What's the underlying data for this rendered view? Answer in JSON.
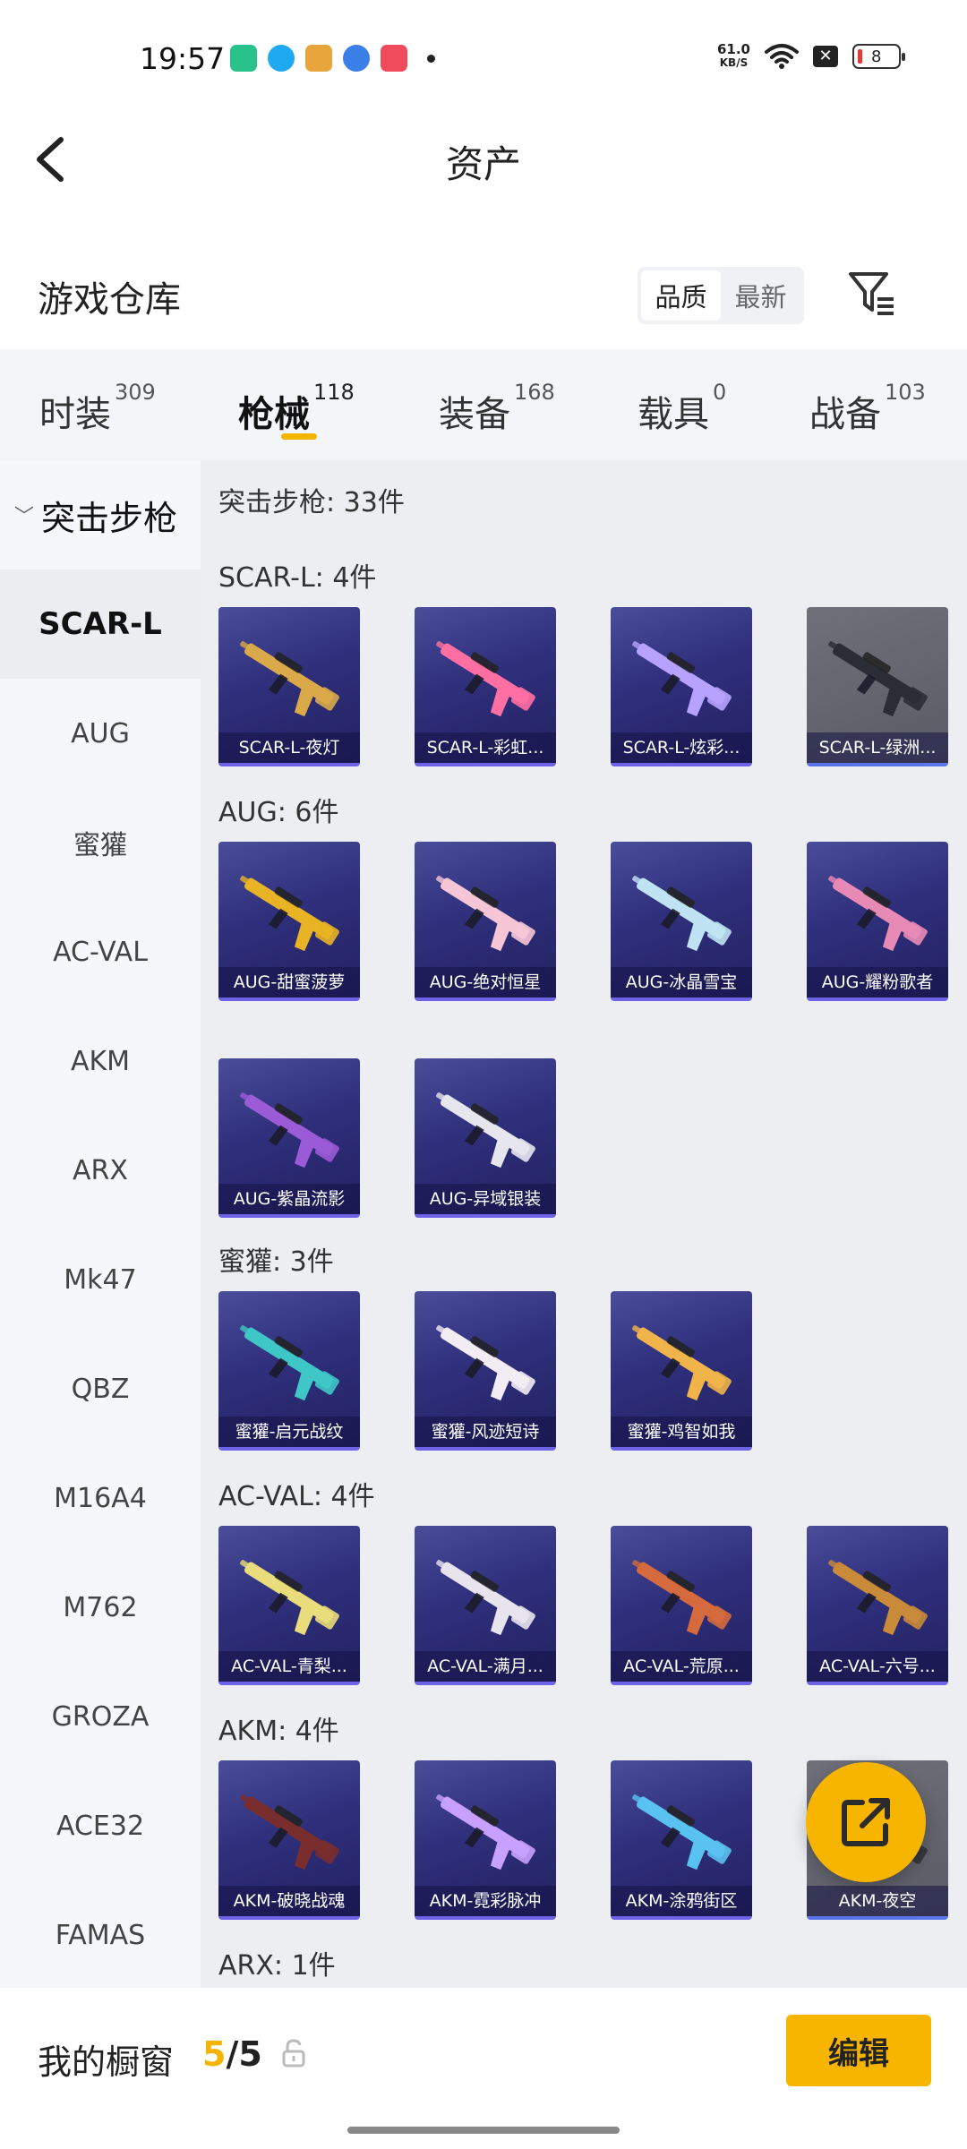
{
  "status_bar": {
    "time": "19:57",
    "net_speed_value": "61.0",
    "net_speed_unit": "KB/S",
    "battery": "8"
  },
  "header": {
    "title": "资产",
    "back_icon": "chevron-left-icon"
  },
  "warehouse": {
    "title": "游戏仓库",
    "sort_options": [
      "品质",
      "最新"
    ],
    "sort_selected": "品质",
    "filter_icon": "filter-icon"
  },
  "tabs": [
    {
      "label": "时装",
      "count": "309"
    },
    {
      "label": "枪械",
      "count": "118",
      "active": true
    },
    {
      "label": "装备",
      "count": "168"
    },
    {
      "label": "载具",
      "count": "0"
    },
    {
      "label": "战备",
      "count": "103"
    }
  ],
  "sidebar": {
    "category": "突击步枪",
    "items": [
      "SCAR-L",
      "AUG",
      "蜜獾",
      "AC-VAL",
      "AKM",
      "ARX",
      "Mk47",
      "QBZ",
      "M16A4",
      "M762",
      "GROZA",
      "ACE32",
      "FAMAS"
    ],
    "selected": "SCAR-L"
  },
  "content": {
    "title": "突击步枪: 33件",
    "groups": [
      {
        "title": "SCAR-L: 4件",
        "items": [
          "SCAR-L-夜灯",
          "SCAR-L-彩虹...",
          "SCAR-L-炫彩...",
          "SCAR-L-绿洲..."
        ]
      },
      {
        "title": "AUG: 6件",
        "items": [
          "AUG-甜蜜菠萝",
          "AUG-绝对恒星",
          "AUG-冰晶雪宝",
          "AUG-耀粉歌者",
          "AUG-紫晶流影",
          "AUG-异域银装"
        ]
      },
      {
        "title": "蜜獾: 3件",
        "items": [
          "蜜獾-启元战纹",
          "蜜獾-风迹短诗",
          "蜜獾-鸡智如我"
        ]
      },
      {
        "title": "AC-VAL: 4件",
        "items": [
          "AC-VAL-青梨...",
          "AC-VAL-满月...",
          "AC-VAL-荒原...",
          "AC-VAL-六号..."
        ]
      },
      {
        "title": "AKM: 4件",
        "items": [
          "AKM-破晓战魂",
          "AKM-霓彩脉冲",
          "AKM-涂鸦街区",
          "AKM-夜空"
        ]
      },
      {
        "title": "ARX: 1件",
        "items": []
      }
    ]
  },
  "bottom": {
    "showcase_label": "我的橱窗",
    "showcase_current": "5",
    "showcase_sep": "/",
    "showcase_total": "5",
    "edit_label": "编辑"
  },
  "colors": {
    "accent": "#f7b500",
    "card_bg": "#2f2f7c",
    "card_border": "#6e63e6"
  }
}
